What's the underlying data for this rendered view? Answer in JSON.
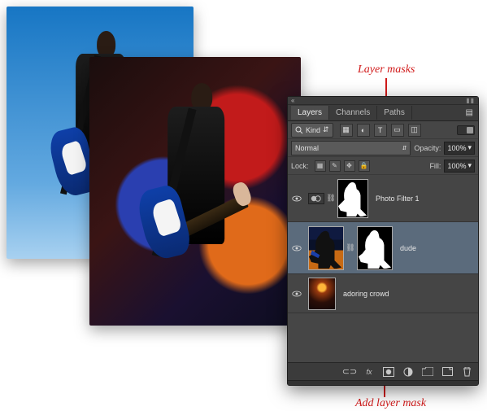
{
  "annotations": {
    "top": "Layer masks",
    "bottom": "Add layer mask"
  },
  "panel": {
    "tabs": {
      "layers": "Layers",
      "channels": "Channels",
      "paths": "Paths"
    },
    "filter": {
      "kind_label": "Kind",
      "icons": {
        "pixel": "▦",
        "adjust": "◐",
        "type": "T",
        "shape": "▭",
        "smart": "◫"
      }
    },
    "blend": {
      "mode": "Normal",
      "opacity_label": "Opacity:",
      "opacity_value": "100%"
    },
    "lock": {
      "label": "Lock:",
      "fill_label": "Fill:",
      "fill_value": "100%"
    },
    "layers": [
      {
        "name": "Photo Filter 1"
      },
      {
        "name": "dude"
      },
      {
        "name": "adoring crowd"
      }
    ],
    "footer_icons": {
      "link": "chain-icon",
      "fx": "fx",
      "mask": "mask",
      "adjust": "adjust",
      "group": "group",
      "new": "new",
      "trash": "trash"
    }
  }
}
